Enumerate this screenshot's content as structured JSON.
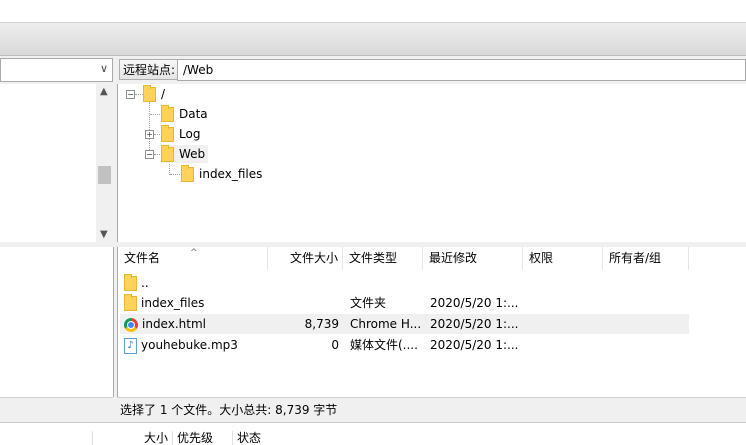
{
  "remote": {
    "label": "远程站点:",
    "path": "/Web"
  },
  "tree": {
    "root": "/",
    "items": [
      {
        "name": "Data",
        "expander": ""
      },
      {
        "name": "Log",
        "expander": "+"
      },
      {
        "name": "Web",
        "expander": "−"
      },
      {
        "name": "index_files",
        "expander": ""
      }
    ],
    "root_expander": "−"
  },
  "file_list": {
    "columns": [
      "文件名",
      "文件大小",
      "文件类型",
      "最近修改",
      "权限",
      "所有者/组"
    ],
    "rows": [
      {
        "name": "..",
        "size": "",
        "type": "",
        "modified": "",
        "icon": "folder-icon"
      },
      {
        "name": "index_files",
        "size": "",
        "type": "文件夹",
        "modified": "2020/5/20 1:...",
        "icon": "folder-icon"
      },
      {
        "name": "index.html",
        "size": "8,739",
        "type": "Chrome H...",
        "modified": "2020/5/20 1:...",
        "icon": "chrome-icon",
        "selected": true
      },
      {
        "name": "youhebuke.mp3",
        "size": "0",
        "type": "媒体文件(....",
        "modified": "2020/5/20 1:...",
        "icon": "music-file-icon"
      }
    ]
  },
  "status_text": "选择了 1 个文件。大小总共: 8,739 字节",
  "queue": {
    "columns": [
      "大小",
      "优先级",
      "状态"
    ]
  },
  "colors": {
    "folder": "#ffd35a",
    "selected_row": "#f0f0f0"
  }
}
